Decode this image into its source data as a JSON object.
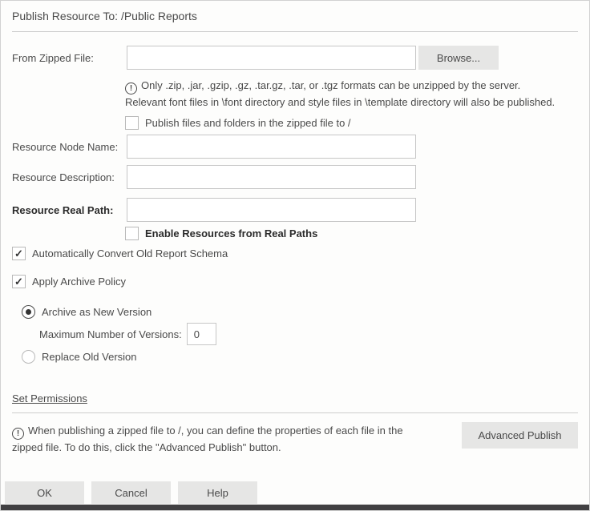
{
  "dialog": {
    "title_label": "Publish Resource To:",
    "title_path": "/Public Reports"
  },
  "form": {
    "from_zipped_file": {
      "label": "From Zipped File:",
      "value": "",
      "browse_label": "Browse..."
    },
    "zip_note_line1": "Only .zip, .jar, .gzip, .gz, .tar.gz, .tar, or .tgz formats can be unzipped by the server.",
    "zip_note_line2": "Relevant font files in \\font directory and style files in \\template directory will also be published.",
    "publish_to_root": {
      "label": "Publish files and folders in the zipped file to /",
      "checked": false
    },
    "resource_node_name": {
      "label": "Resource Node Name:",
      "value": ""
    },
    "resource_description": {
      "label": "Resource Description:",
      "value": ""
    },
    "resource_real_path": {
      "label": "Resource Real Path:",
      "value": ""
    },
    "enable_real_paths": {
      "label": "Enable Resources from Real Paths",
      "checked": false
    },
    "auto_convert": {
      "label": "Automatically Convert Old Report Schema",
      "checked": true
    },
    "apply_archive_policy": {
      "label": "Apply Archive Policy",
      "checked": true
    },
    "archive_new_version": {
      "label": "Archive as New Version",
      "selected": true
    },
    "max_versions": {
      "label": "Maximum Number of Versions:",
      "value": "0"
    },
    "replace_old_version": {
      "label": "Replace Old Version",
      "selected": false
    },
    "set_permissions_label": "Set Permissions"
  },
  "footer": {
    "note_line1": "When publishing a zipped file to /, you can define the properties of each file in the",
    "note_line2": "zipped file. To do this, click the \"Advanced Publish\" button.",
    "advanced_publish_label": "Advanced Publish",
    "ok_label": "OK",
    "cancel_label": "Cancel",
    "help_label": "Help"
  },
  "icons": {
    "info": "!",
    "check": "✓"
  },
  "colors": {
    "text": "#4a4a4a",
    "button_bg": "#e6e6e5",
    "input_border": "#c6c6c6",
    "divider": "#cccccc",
    "bottom_bar": "#414042"
  }
}
